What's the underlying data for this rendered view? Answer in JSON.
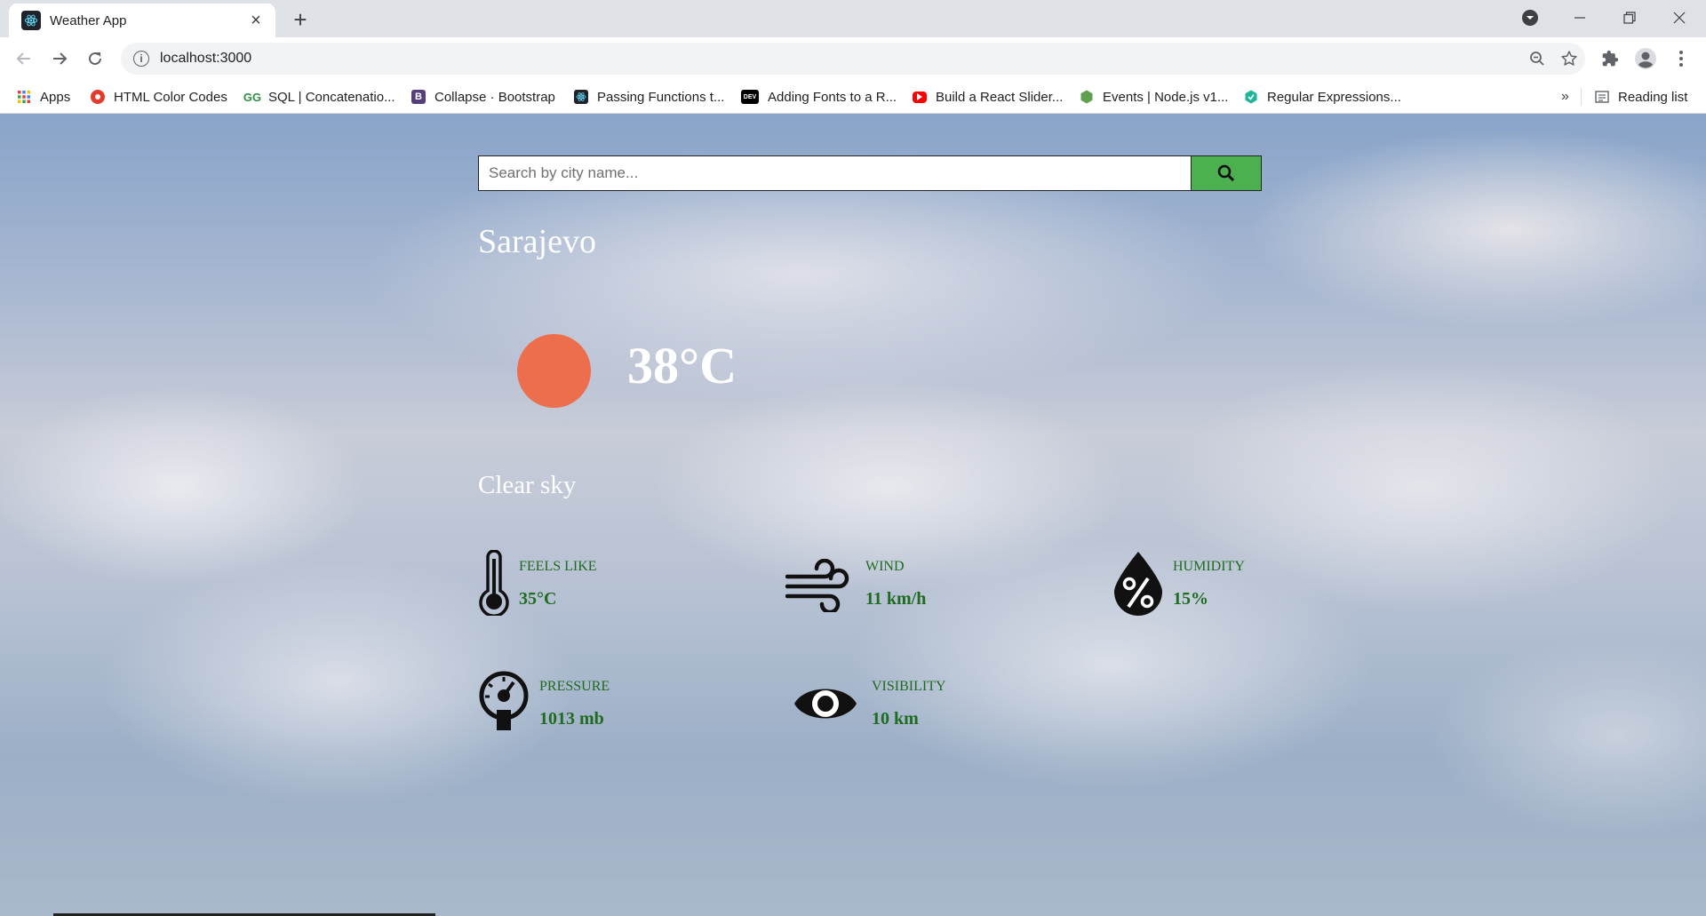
{
  "browser": {
    "tab_title": "Weather App",
    "url": "localhost:3000",
    "bookmarks": [
      {
        "label": "Apps",
        "icon": "apps-grid-icon"
      },
      {
        "label": "HTML Color Codes",
        "icon": "html-color-codes-icon"
      },
      {
        "label": "SQL | Concatenatio...",
        "icon": "geeksforgeeks-icon"
      },
      {
        "label": "Collapse · Bootstrap",
        "icon": "bootstrap-icon"
      },
      {
        "label": "Passing Functions t...",
        "icon": "react-icon"
      },
      {
        "label": "Adding Fonts to a R...",
        "icon": "dev-icon"
      },
      {
        "label": "Build a React Slider...",
        "icon": "youtube-icon"
      },
      {
        "label": "Events | Node.js v1...",
        "icon": "nodejs-icon"
      },
      {
        "label": "Regular Expressions...",
        "icon": "regex-icon"
      }
    ],
    "overflow_label": "»",
    "reading_list_label": "Reading list"
  },
  "search": {
    "placeholder": "Search by city name...",
    "button_color": "#4caf50"
  },
  "weather": {
    "city": "Sarajevo",
    "temperature": "38°C",
    "description": "Clear sky",
    "sun_color": "#ec6e4c",
    "stats": {
      "feels_like": {
        "label": "FEELS LIKE",
        "value": "35°C",
        "icon": "thermometer-icon"
      },
      "wind": {
        "label": "WIND",
        "value": "11 km/h",
        "icon": "wind-icon"
      },
      "humidity": {
        "label": "HUMIDITY",
        "value": "15%",
        "icon": "humidity-drop-icon"
      },
      "pressure": {
        "label": "PRESSURE",
        "value": "1013 mb",
        "icon": "pressure-gauge-icon"
      },
      "visibility": {
        "label": "VISIBILITY",
        "value": "10 km",
        "icon": "eye-icon"
      }
    }
  }
}
